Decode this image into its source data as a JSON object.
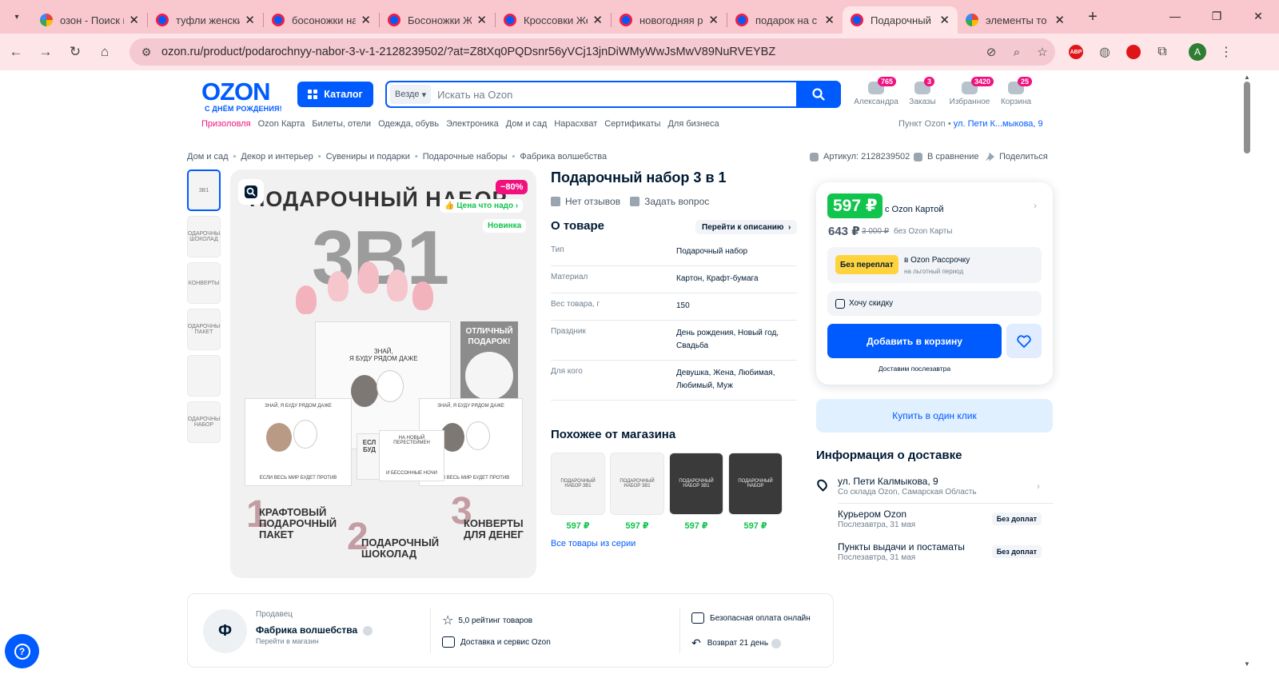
{
  "browser": {
    "tabs": [
      {
        "title": "озон - Поиск в",
        "favicon": "google"
      },
      {
        "title": "туфли женские",
        "favicon": "ozon"
      },
      {
        "title": "босоножки на",
        "favicon": "ozon"
      },
      {
        "title": "Босоножки Жен",
        "favicon": "ozon"
      },
      {
        "title": "Кроссовки Жен",
        "favicon": "ozon"
      },
      {
        "title": "новогодняя рас",
        "favicon": "ozon"
      },
      {
        "title": "подарок на с",
        "favicon": "ozon"
      },
      {
        "title": "Подарочный на",
        "favicon": "ozon",
        "active": true
      },
      {
        "title": "элементы то",
        "favicon": "google"
      }
    ],
    "url": "ozon.ru/product/podarochnyy-nabor-3-v-1-2128239502/?at=Z8tXq0PQDsnr56yVCj13jnDiWMyWwJsMwV89NuRVEYBZ",
    "profile_initial": "A"
  },
  "header": {
    "logo": "OZON",
    "logo_sub": "С ДНЁМ РОЖДЕНИЯ!",
    "catalog_label": "Каталог",
    "search_scope": "Везде",
    "search_placeholder": "Искать на Ozon",
    "icons": [
      {
        "label": "Александра",
        "badge": "765"
      },
      {
        "label": "Заказы",
        "badge": "3"
      },
      {
        "label": "Избранное",
        "badge": "3420"
      },
      {
        "label": "Корзина",
        "badge": "25"
      }
    ],
    "menu": [
      "Призоловля",
      "Ozon Карта",
      "Билеты, отели",
      "Одежда, обувь",
      "Электроника",
      "Дом и сад",
      "Нарасхват",
      "Сертификаты",
      "Для бизнеса"
    ],
    "pickup_label": "Пункт Ozon",
    "pickup_address": "ул. Пети К...мыкова, 9"
  },
  "breadcrumbs": [
    "Дом и сад",
    "Декор и интерьер",
    "Сувениры и подарки",
    "Подарочные наборы",
    "Фабрика волшебства"
  ],
  "meta": {
    "sku": "Артикул: 2128239502",
    "compare": "В сравнение",
    "share": "Поделиться"
  },
  "gallery": {
    "thumbs": [
      "3В1",
      "ПОДАРОЧНЫЙ ШОКОЛАД",
      "КОНВЕРТЫ",
      "ПОДАРОЧНЫЙ ПАКЕТ",
      "",
      "ПОДАРОЧНЫЙ НАБОР"
    ],
    "badge_sale": "−80%",
    "badge_need": "Цена что надо",
    "badge_new": "Новинка",
    "image": {
      "title": "ПОДАРОЧНЫЙ НАБОР",
      "big": "3В1",
      "bag_text": "ЗНАЙ,\nЯ БУДУ РЯДОМ ДАЖЕ",
      "gift_text": "ОТЛИЧНЫЙ\nПОДАРОК!",
      "env1_top": "ЗНАЙ, Я БУДУ РЯДОМ ДАЖЕ",
      "env1_bottom": "ЕСЛИ ВЕСЬ МИР БУДЕТ ПРОТИВ",
      "env2_top": "НА НОВЫЙ ПЕРЕСТЕЙМЕН",
      "env2_bottom": "И БЕССОННЫЕ НОЧИ",
      "env3_top": "ЗНАЙ, Я БУДУ РЯДОМ ДАЖЕ",
      "env3_bottom": "ЕСЛИ ВЕСЬ МИР БУДЕТ ПРОТИВ",
      "mid_text": "ЕСЛ\nБУД",
      "label1": "КРАФТОВЫЙ\nПОДАРОЧНЫЙ\nПАКЕТ",
      "label2": "ПОДАРОЧНЫЙ\nШОКОЛАД",
      "label3": "КОНВЕРТЫ\nДЛЯ ДЕНЕГ",
      "n1": "1",
      "n2": "2",
      "n3": "3"
    }
  },
  "product": {
    "title": "Подарочный набор 3 в 1",
    "reviews": "Нет отзывов",
    "ask": "Задать вопрос",
    "about_title": "О товаре",
    "go_desc": "Перейти к описанию",
    "specs": [
      {
        "k": "Тип",
        "v": "Подарочный набор"
      },
      {
        "k": "Материал",
        "v": "Картон, Крафт-бумага"
      },
      {
        "k": "Вес товара, г",
        "v": "150"
      },
      {
        "k": "Праздник",
        "v": "День рождения, Новый год, Свадьба"
      },
      {
        "k": "Для кого",
        "v": "Девушка, Жена, Любимая, Любимый, Муж"
      }
    ],
    "similar_title": "Похожее от магазина",
    "similar": [
      {
        "img": "ПОДАРОЧНЫЙ НАБОР 3В1",
        "price": "597 ₽",
        "dark": false
      },
      {
        "img": "ПОДАРОЧНЫЙ НАБОР 3В1",
        "price": "597 ₽",
        "dark": false
      },
      {
        "img": "ПОДАРОЧНЫЙ НАБОР 3В1",
        "price": "597 ₽",
        "dark": true
      },
      {
        "img": "ПОДАРОЧНЫЙ НАБОР",
        "price": "597 ₽",
        "dark": true
      }
    ],
    "all_series": "Все товары из серии"
  },
  "buy": {
    "price_card": "597 ₽",
    "with_card": "с Ozon Картой",
    "price": "643 ₽",
    "old_price": "3 000 ₽",
    "without_card": "без Ozon Карты",
    "installment_tag": "Без переплат",
    "installment_title": "в Ozon Рассрочку",
    "installment_sub": "на льготный период",
    "discount": "Хочу скидку",
    "add_to_cart": "Добавить в корзину",
    "delivery_note": "Доставим послезавтра",
    "one_click": "Купить в один клик"
  },
  "delivery": {
    "title": "Информация о доставке",
    "rows": [
      {
        "t": "ул. Пети Калмыкова, 9",
        "s": "Со склада Ozon, Самарская Область",
        "badge": ""
      },
      {
        "t": "Курьером Ozon",
        "s": "Послезавтра, 31 мая",
        "badge": "Без доплат"
      },
      {
        "t": "Пункты выдачи и постаматы",
        "s": "Послезавтра, 31 мая",
        "badge": "Без доплат"
      }
    ]
  },
  "seller": {
    "avatar": "Ф",
    "label": "Продавец",
    "name": "Фабрика волшебства",
    "go": "Перейти в магазин",
    "rating": "5,0 рейтинг товаров",
    "service": "Доставка и сервис Ozon",
    "safe_pay": "Безопасная оплата онлайн",
    "return": "Возврат 21 день"
  },
  "colors": {
    "ozon_blue": "#005bff",
    "ozon_green": "#10c44c",
    "ozon_pink": "#f1117e",
    "chrome_tabbar": "#f9c8cf"
  }
}
